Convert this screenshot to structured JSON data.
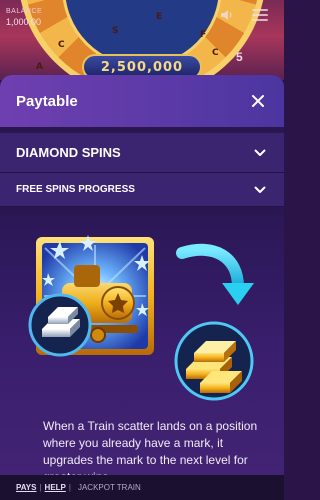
{
  "background": {
    "balance_label": "BALANCE",
    "balance_value": "1,000.00",
    "jackpot_value": "2,500,000",
    "wheel_letters": [
      "A",
      "C",
      "S",
      "F",
      "C",
      "E"
    ],
    "corner_amount": "5"
  },
  "modal": {
    "title": "Paytable",
    "close_icon": "close-icon",
    "sections": [
      {
        "label": "DIAMOND SPINS",
        "icon": "chevron-down-icon"
      },
      {
        "label": "FREE SPINS PROGRESS",
        "icon": "chevron-down-icon"
      }
    ],
    "description": "When a Train scatter lands on a position where you already have a mark, it upgrades the mark to the next level for greater wins."
  },
  "footer": {
    "pays": "PAYS",
    "help": "HELP",
    "game_name": "JACKPOT TRAIN"
  },
  "colors": {
    "header_gradient_start": "#6f3fb0",
    "section_bg": "#3b2470",
    "content_bg": "#2b1756",
    "arrow_cyan": "#2ad0f0",
    "gold": "#f4c22a"
  }
}
